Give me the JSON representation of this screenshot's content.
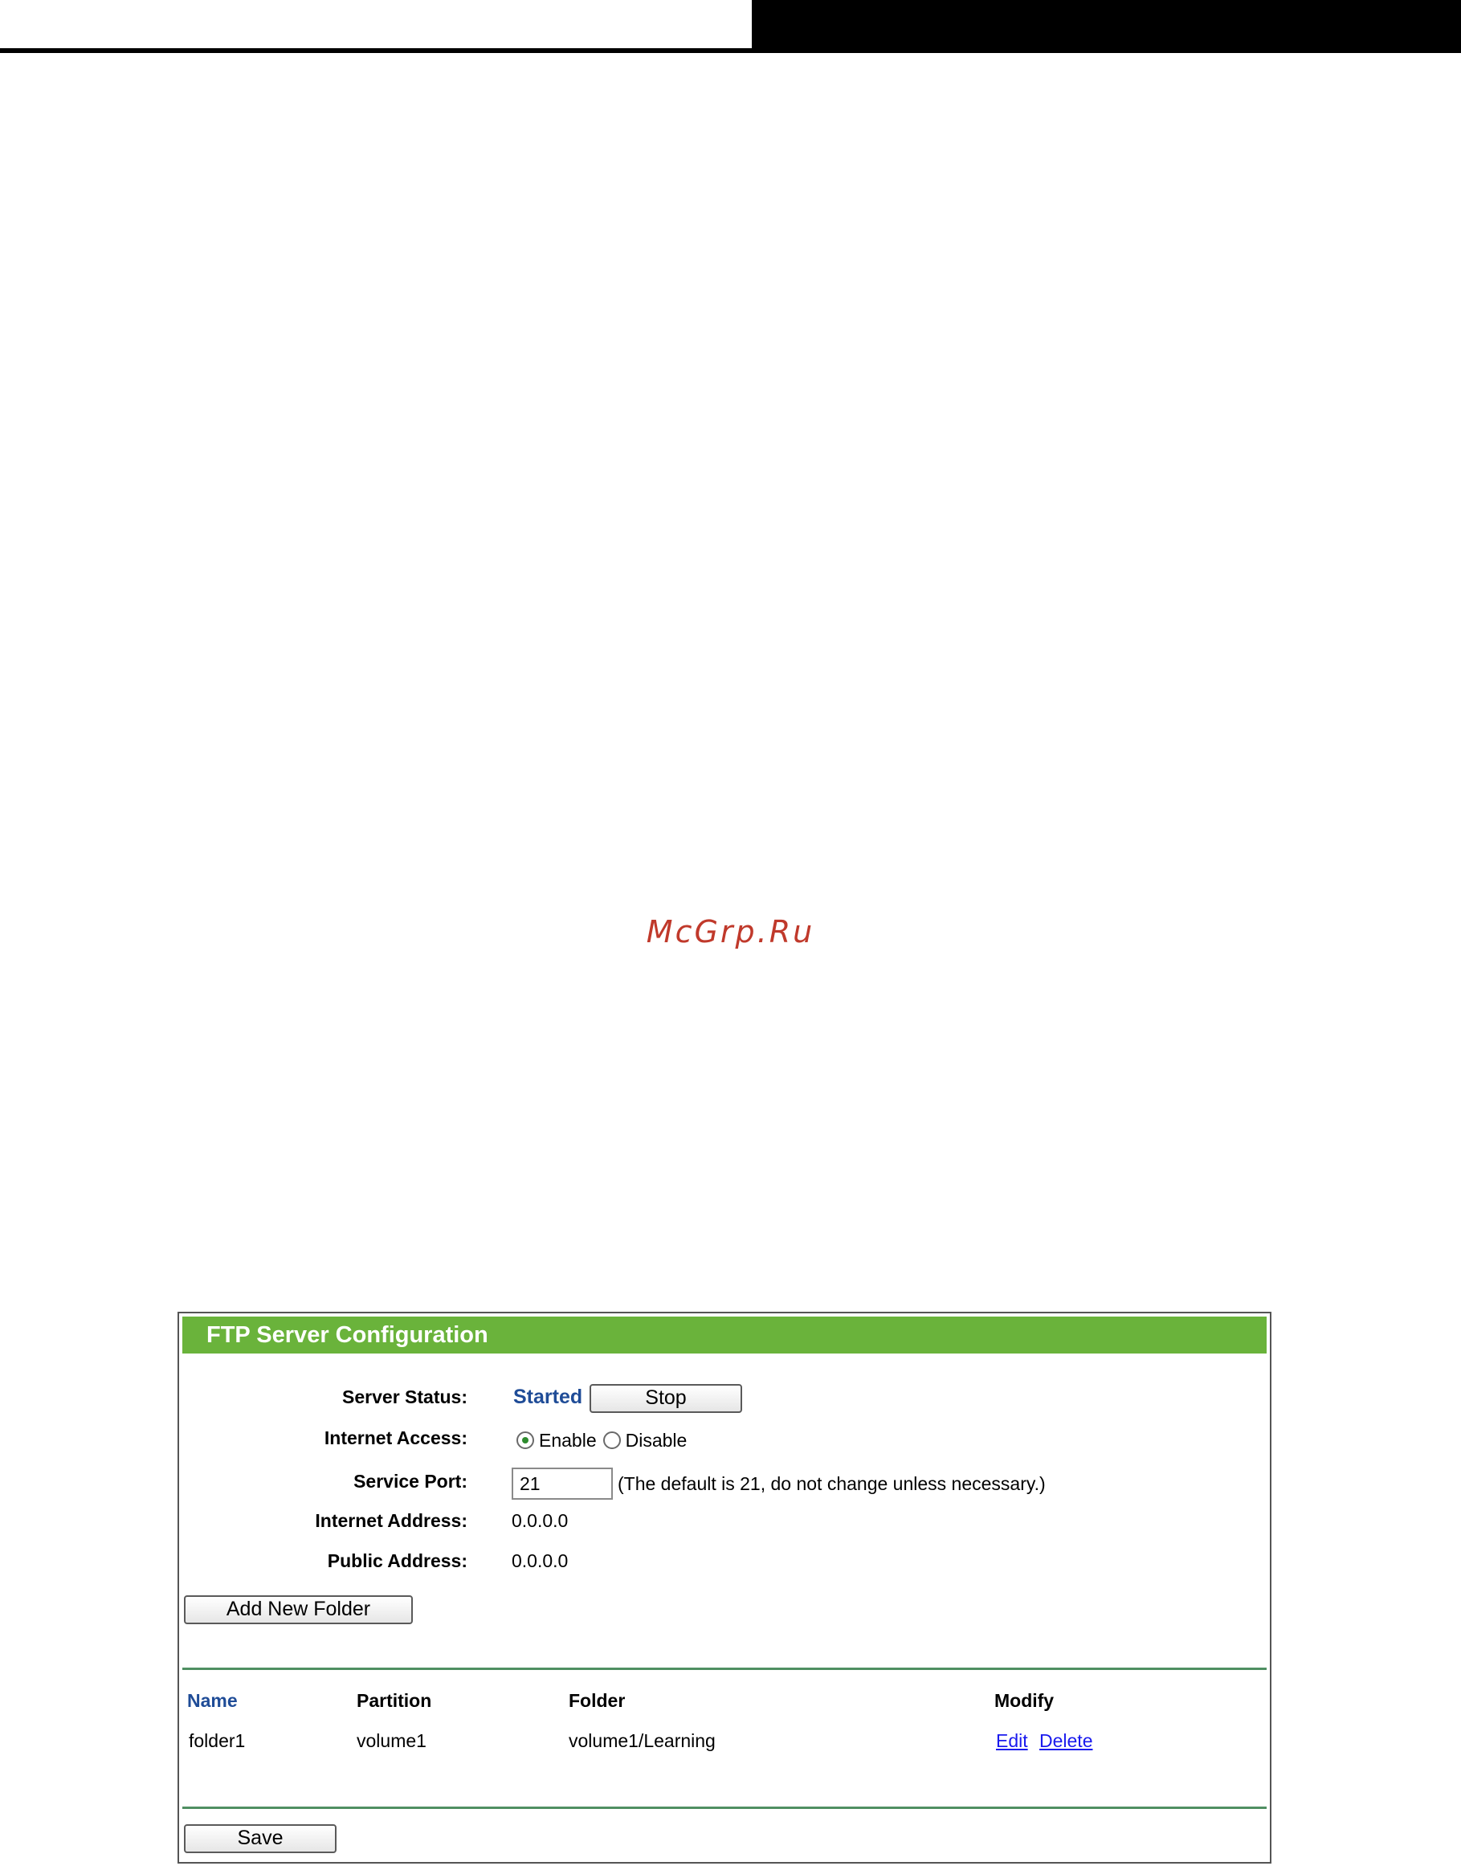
{
  "watermark": "McGrp.Ru",
  "panel": {
    "title": "FTP Server Configuration"
  },
  "server_status": {
    "label": "Server Status:",
    "value": "Started",
    "stop_button": "Stop"
  },
  "internet_access": {
    "label": "Internet Access:",
    "options": [
      "Enable",
      "Disable"
    ],
    "selected": "Enable"
  },
  "service_port": {
    "label": "Service Port:",
    "value": "21",
    "hint": "(The default is 21, do not change unless necessary.)"
  },
  "internet_address": {
    "label": "Internet Address:",
    "value": "0.0.0.0"
  },
  "public_address": {
    "label": "Public Address:",
    "value": "0.0.0.0"
  },
  "add_folder_button": "Add New Folder",
  "folder_table": {
    "columns": [
      "Name",
      "Partition",
      "Folder",
      "Modify"
    ],
    "rows": [
      {
        "name": "folder1",
        "partition": "volume1",
        "folder": "volume1/Learning",
        "actions": [
          "Edit",
          "Delete"
        ]
      }
    ]
  },
  "save_button": "Save",
  "colors": {
    "title_bar": "#6ab33b",
    "status_text": "#1f4c97",
    "link": "#1a1aee",
    "divider": "#4f8f62"
  }
}
